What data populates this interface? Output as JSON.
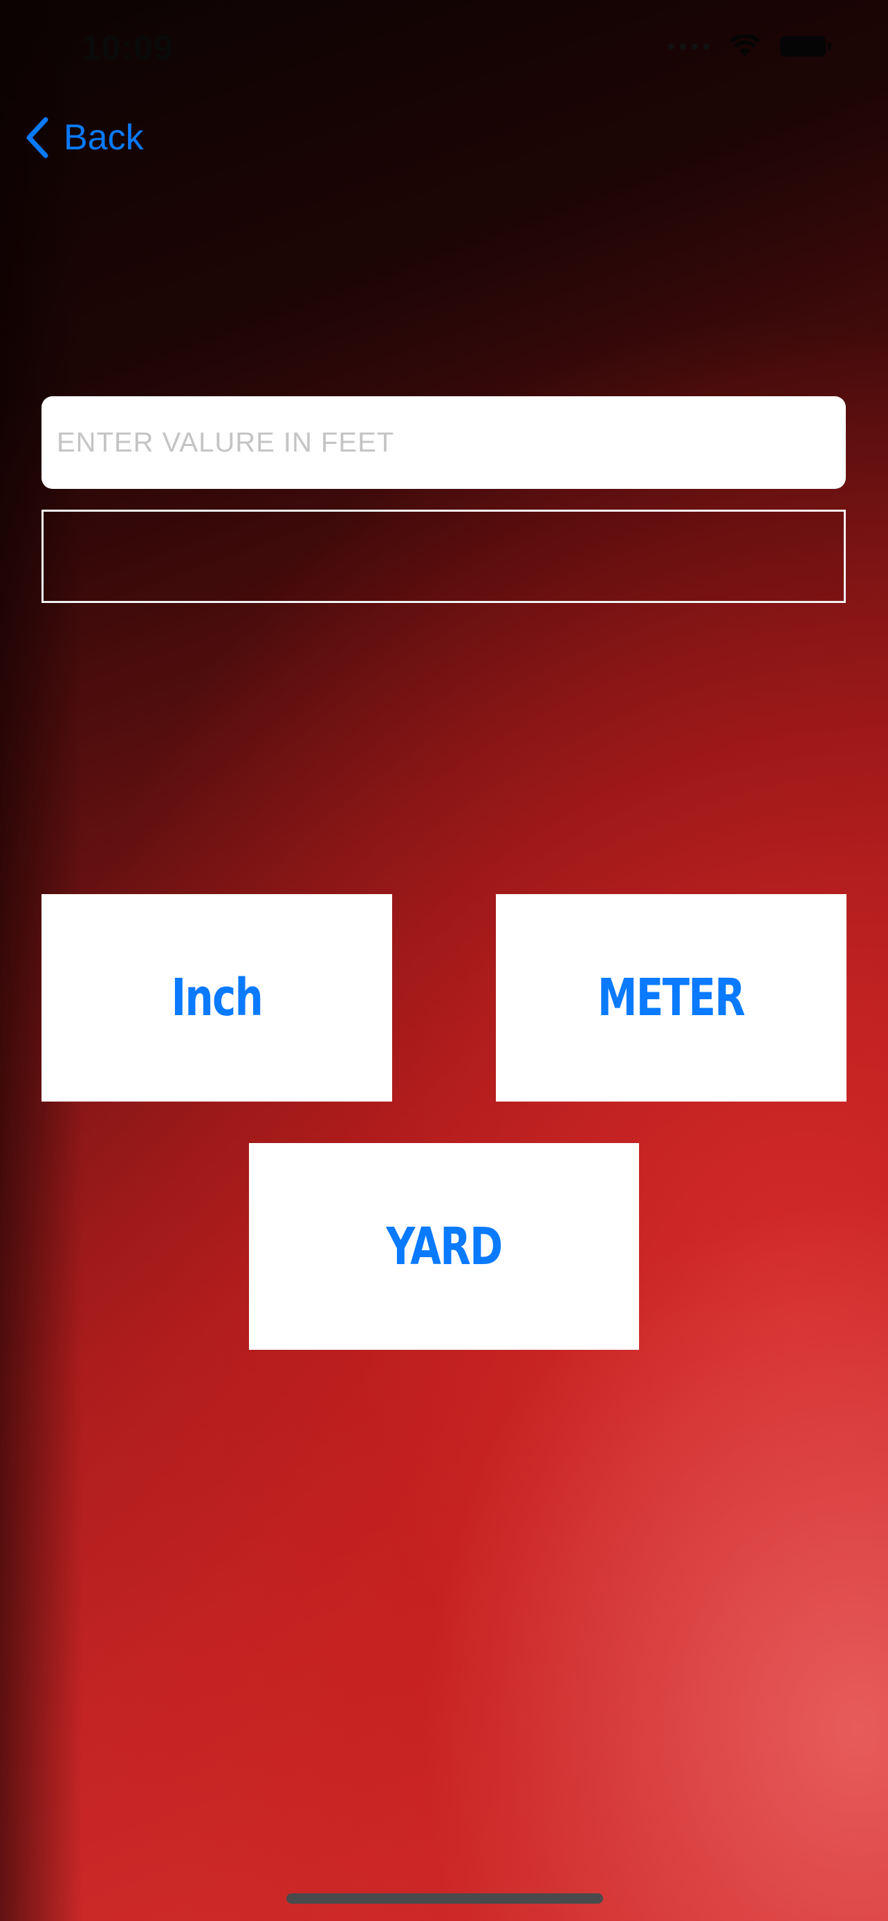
{
  "status_bar": {
    "time": "10:09",
    "icons": [
      "cellular-icon",
      "wifi-icon",
      "battery-icon"
    ]
  },
  "nav": {
    "back_label": "Back"
  },
  "converter": {
    "input_placeholder": "ENTER VALURE IN FEET",
    "input_value": "",
    "result_value": ""
  },
  "buttons": {
    "inch_label": "Inch",
    "meter_label": "METER",
    "yard_label": "YARD"
  },
  "colors": {
    "accent": "#0a7aff",
    "background_dark": "#1d0505",
    "background_red": "#c42424",
    "button_bg": "#ffffff"
  }
}
